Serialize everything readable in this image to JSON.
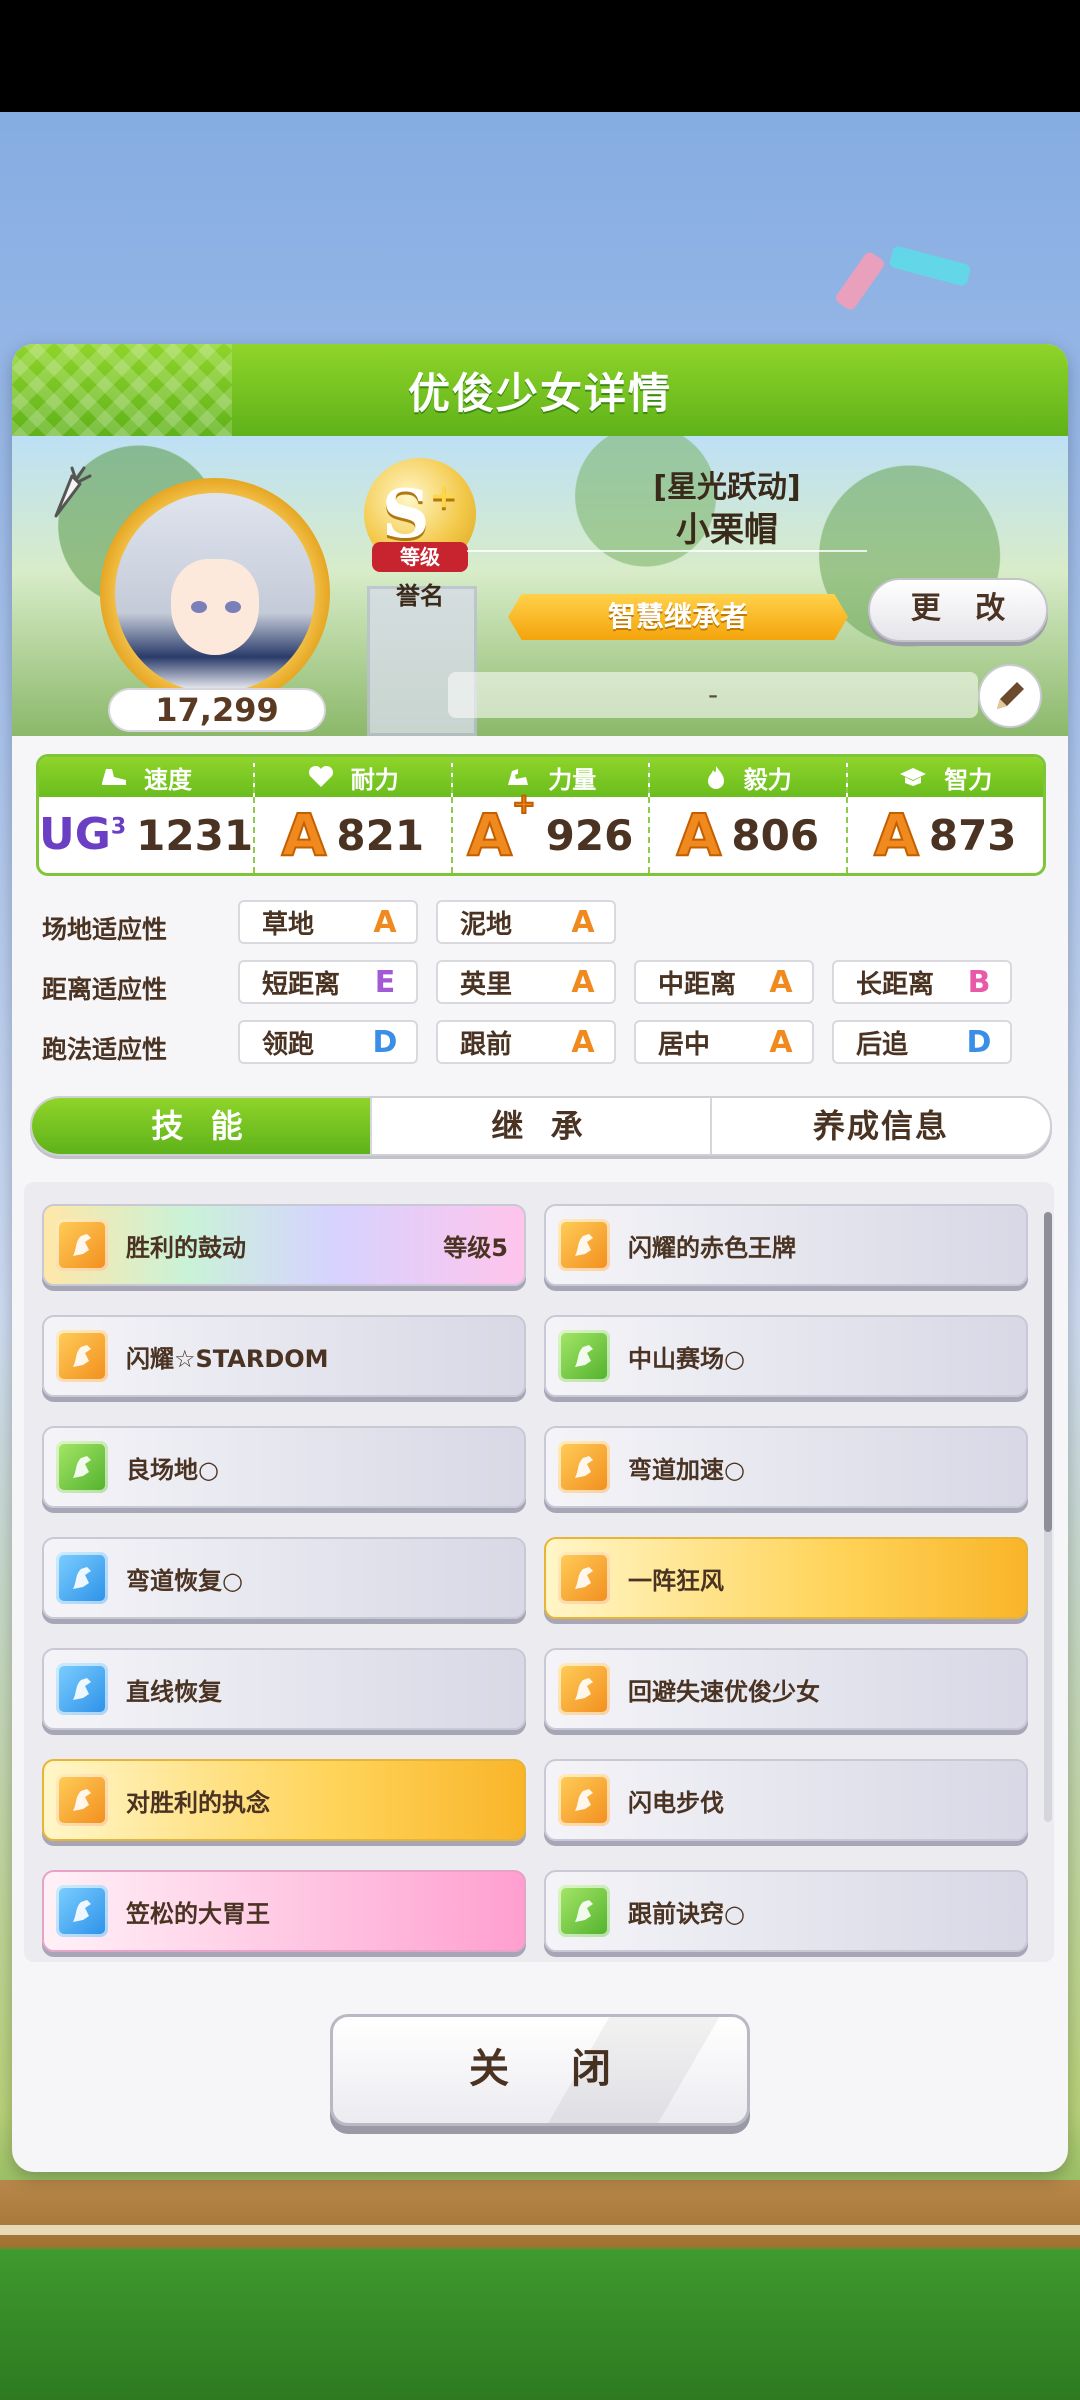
{
  "panel": {
    "title": "优俊少女详情"
  },
  "profile": {
    "fans": "17,299",
    "rank_letter": "S",
    "rank_plus": "+",
    "rank_ribbon": "等级",
    "rank_caption": "誉名",
    "costume_title": "[星光跃动]",
    "name": "小栗帽",
    "epithet": "智慧继承者",
    "change_label": "更 改",
    "memo": "-"
  },
  "stats": [
    {
      "label": "速度",
      "icon": "shoe-icon",
      "grade": "UG",
      "grade_sub": "3",
      "value": "1231"
    },
    {
      "label": "耐力",
      "icon": "heart-icon",
      "grade": "A",
      "grade_sub": "",
      "value": "821"
    },
    {
      "label": "力量",
      "icon": "muscle-icon",
      "grade": "A",
      "grade_sub": "+",
      "value": "926"
    },
    {
      "label": "毅力",
      "icon": "flame-icon",
      "grade": "A",
      "grade_sub": "",
      "value": "806"
    },
    {
      "label": "智力",
      "icon": "graduation-cap-icon",
      "grade": "A",
      "grade_sub": "",
      "value": "873"
    }
  ],
  "aptitude": {
    "track": {
      "label": "场地适应性",
      "items": [
        {
          "name": "草地",
          "grade": "A"
        },
        {
          "name": "泥地",
          "grade": "A"
        }
      ]
    },
    "distance": {
      "label": "距离适应性",
      "items": [
        {
          "name": "短距离",
          "grade": "E"
        },
        {
          "name": "英里",
          "grade": "A"
        },
        {
          "name": "中距离",
          "grade": "A"
        },
        {
          "name": "长距离",
          "grade": "B"
        }
      ]
    },
    "strategy": {
      "label": "跑法适应性",
      "items": [
        {
          "name": "领跑",
          "grade": "D"
        },
        {
          "name": "跟前",
          "grade": "A"
        },
        {
          "name": "居中",
          "grade": "A"
        },
        {
          "name": "后追",
          "grade": "D"
        }
      ]
    }
  },
  "grade_colors": {
    "A": "#f08a1e",
    "B": "#e85aa8",
    "D": "#3a8ee6",
    "E": "#a25ad6"
  },
  "tabs": [
    {
      "label": "技 能",
      "active": true
    },
    {
      "label": "继 承",
      "active": false
    },
    {
      "label": "养成信息",
      "active": false
    }
  ],
  "skills": [
    {
      "name": "胜利的鼓动",
      "level": "等级5",
      "style": "rainbow",
      "icon": "orange"
    },
    {
      "name": "闪耀的赤色王牌",
      "level": "",
      "style": "normal",
      "icon": "orange"
    },
    {
      "name": "闪耀☆STARDOM",
      "level": "",
      "style": "normal",
      "icon": "orange"
    },
    {
      "name": "中山赛场○",
      "level": "",
      "style": "normal",
      "icon": "green"
    },
    {
      "name": "良场地○",
      "level": "",
      "style": "normal",
      "icon": "green"
    },
    {
      "name": "弯道加速○",
      "level": "",
      "style": "normal",
      "icon": "orange"
    },
    {
      "name": "弯道恢复○",
      "level": "",
      "style": "normal",
      "icon": "blue"
    },
    {
      "name": "一阵狂风",
      "level": "",
      "style": "gold",
      "icon": "orange"
    },
    {
      "name": "直线恢复",
      "level": "",
      "style": "normal",
      "icon": "blue"
    },
    {
      "name": "回避失速优俊少女",
      "level": "",
      "style": "normal",
      "icon": "orange"
    },
    {
      "name": "对胜利的执念",
      "level": "",
      "style": "gold",
      "icon": "orange"
    },
    {
      "name": "闪电步伐",
      "level": "",
      "style": "normal",
      "icon": "orange"
    },
    {
      "name": "笠松的大胃王",
      "level": "",
      "style": "pink",
      "icon": "blue"
    },
    {
      "name": "跟前诀窍○",
      "level": "",
      "style": "normal",
      "icon": "green"
    }
  ],
  "close_label": "关 闭"
}
